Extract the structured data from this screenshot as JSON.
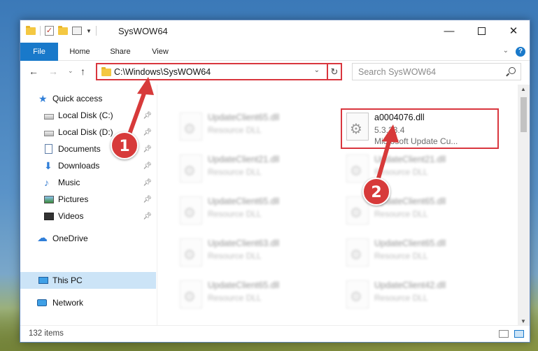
{
  "window": {
    "title": "SysWOW64"
  },
  "ribbon": {
    "tabs": [
      "File",
      "Home",
      "Share",
      "View"
    ]
  },
  "address": {
    "path": "C:\\Windows\\SysWOW64"
  },
  "search": {
    "placeholder": "Search SysWOW64"
  },
  "nav": {
    "items": [
      {
        "label": "Quick access",
        "icon": "star-icon",
        "pinned": false
      },
      {
        "label": "Local Disk (C:)",
        "icon": "drive-icon",
        "pinned": true
      },
      {
        "label": "Local Disk (D:)",
        "icon": "drive-icon",
        "pinned": true
      },
      {
        "label": "Documents",
        "icon": "documents-icon",
        "pinned": true
      },
      {
        "label": "Downloads",
        "icon": "download-icon",
        "pinned": true
      },
      {
        "label": "Music",
        "icon": "music-icon",
        "pinned": true
      },
      {
        "label": "Pictures",
        "icon": "pictures-icon",
        "pinned": true
      },
      {
        "label": "Videos",
        "icon": "videos-icon",
        "pinned": true
      },
      {
        "label": "OneDrive",
        "icon": "onedrive-icon",
        "pinned": false
      },
      {
        "label": "This PC",
        "icon": "pc-icon",
        "pinned": false,
        "selected": true
      },
      {
        "label": "Network",
        "icon": "network-icon",
        "pinned": false
      }
    ]
  },
  "files": {
    "left": [
      {
        "name": "UpdateClient65.dll",
        "type": "Resource DLL"
      },
      {
        "name": "UpdateClient21.dll",
        "type": "Resource DLL"
      },
      {
        "name": "UpdateClient65.dll",
        "type": "Resource DLL"
      },
      {
        "name": "UpdateClient63.dll",
        "type": "Resource DLL"
      },
      {
        "name": "UpdateClient65.dll",
        "type": "Resource DLL"
      }
    ],
    "right": [
      {
        "name": "a0004076.dll",
        "version": "5.3.23.4",
        "description": "Microsoft Update Cu..."
      },
      {
        "name": "UpdateClient21.dll",
        "type": "Resource DLL"
      },
      {
        "name": "UpdateClient65.dll",
        "type": "Resource DLL"
      },
      {
        "name": "UpdateClient65.dll",
        "type": "Resource DLL"
      },
      {
        "name": "UpdateClient42.dll",
        "type": "Resource DLL"
      }
    ]
  },
  "status": {
    "item_count": "132 items"
  },
  "steps": {
    "one": "1",
    "two": "2"
  },
  "colors": {
    "accent": "#1979ca",
    "highlight": "#d9363e",
    "selection": "#cce4f7"
  }
}
